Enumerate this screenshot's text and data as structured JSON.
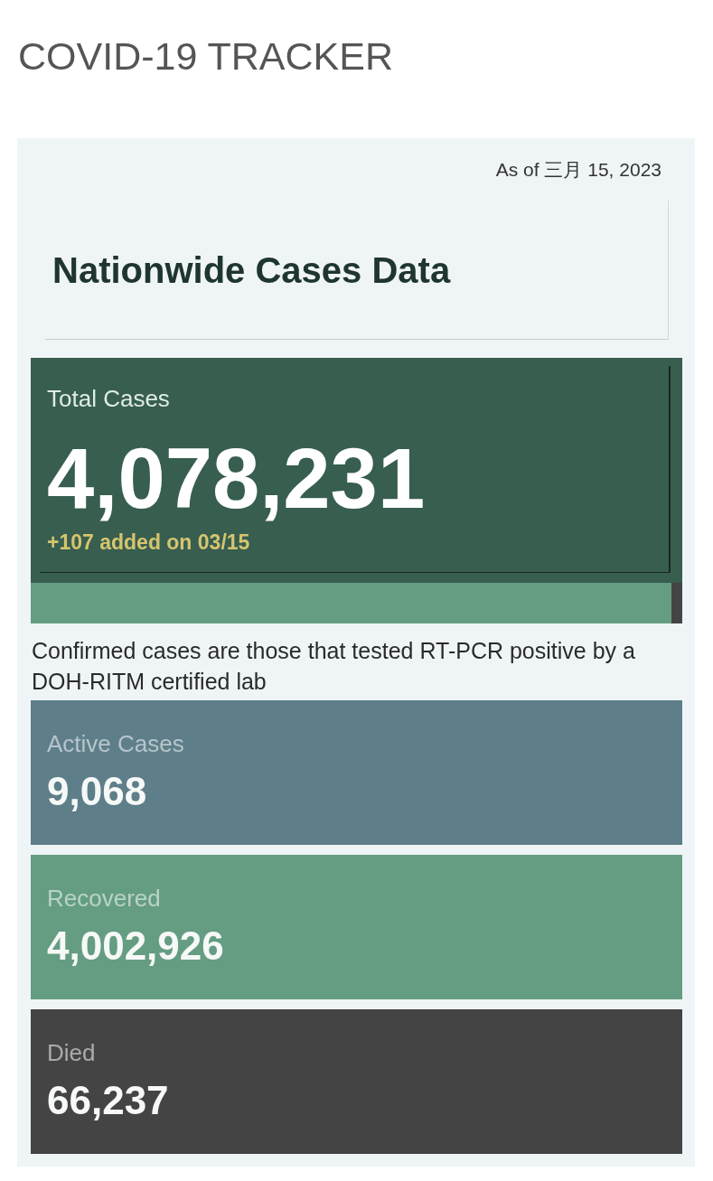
{
  "title": "COVID-19 TRACKER",
  "as_of": "As of 三月 15, 2023",
  "heading": "Nationwide Cases Data",
  "total": {
    "label": "Total Cases",
    "value": "4,078,231",
    "added": "+107 added on 03/15"
  },
  "note": "Confirmed cases are those that tested RT-PCR positive by a DOH-RITM certified lab",
  "stats": [
    {
      "label": "Active Cases",
      "value": "9,068",
      "color": "#5e7e8a"
    },
    {
      "label": "Recovered",
      "value": "4,002,926",
      "color": "#659d82"
    },
    {
      "label": "Died",
      "value": "66,237",
      "color": "#444444"
    }
  ]
}
